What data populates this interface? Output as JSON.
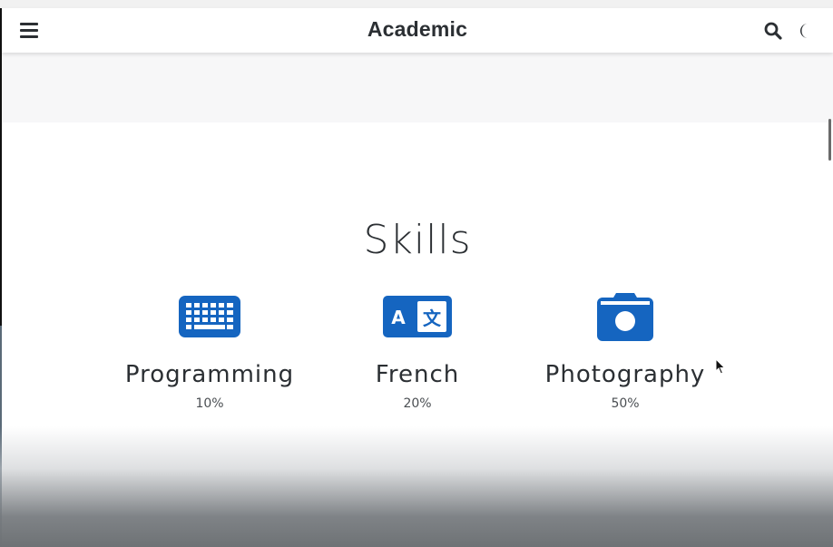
{
  "navbar": {
    "brand": "Academic",
    "menu_icon": "hamburger-menu-icon",
    "search_icon": "search-icon",
    "theme_icon": "moon-icon"
  },
  "skills": {
    "title": "Skills",
    "items": [
      {
        "name": "Programming",
        "percent": "10%",
        "icon": "keyboard-icon"
      },
      {
        "name": "French",
        "percent": "20%",
        "icon": "language-icon"
      },
      {
        "name": "Photography",
        "percent": "50%",
        "icon": "camera-icon"
      }
    ]
  },
  "colors": {
    "icon_blue": "#1565c0",
    "text_dark": "#2b2f33",
    "band_grey": "#f7f7f8"
  }
}
